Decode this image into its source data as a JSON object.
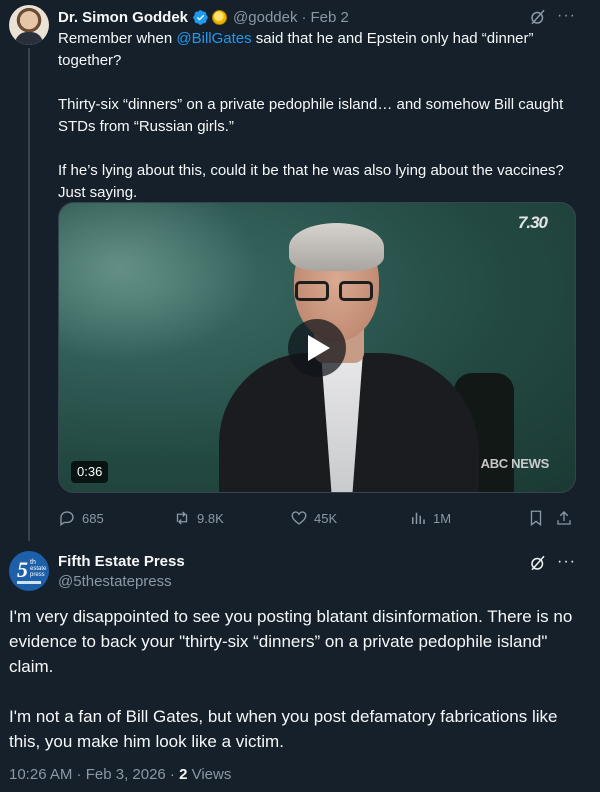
{
  "parent_tweet": {
    "author_name": "Dr. Simon Goddek",
    "handle": "@goddek",
    "separator": "·",
    "date": "Feb 2",
    "text_before_mention": "Remember when ",
    "mention": "@BillGates",
    "text_after_mention": " said that he and Epstein only had “dinner” together?",
    "paragraph_2": "Thirty-six “dinners” on a private pedophile island… and somehow Bill caught STDs from “Russian girls.”",
    "paragraph_3": "If he’s lying about this, could it be that he was also lying about the vaccines? Just saying.",
    "video": {
      "channel_logo": "7.30",
      "network_watermark": "ABC NEWS",
      "duration": "0:36"
    },
    "stats": {
      "replies": "685",
      "reposts": "9.8K",
      "likes": "45K",
      "views": "1M"
    }
  },
  "reply_tweet": {
    "author_name": "Fifth Estate Press",
    "handle": "@5thestatepress",
    "avatar_text": {
      "numeral": "5",
      "ordinal": "th",
      "line1": "estate",
      "line2": "press"
    },
    "paragraph_1": "I'm very disappointed to see you posting blatant disinformation. There is no evidence to back your \"thirty-six “dinners” on a private pedophile island\" claim.",
    "paragraph_2": "I'm not a fan of Bill Gates, but when you post defamatory fabrications like this, you make him look like a victim.",
    "timestamp": "10:26 AM · Feb 3, 2026 · ",
    "views_count": "2",
    "views_label": " Views"
  },
  "colors": {
    "background": "#15202b",
    "text_primary": "#f7f9f9",
    "text_secondary": "#8b98a5",
    "accent": "#1d9bf0",
    "divider": "#38444d"
  },
  "icons": [
    "verified-badge-icon",
    "gold-badge-icon",
    "grok-icon",
    "more-icon",
    "play-icon",
    "reply-icon",
    "repost-icon",
    "like-icon",
    "views-icon",
    "bookmark-icon",
    "share-icon"
  ]
}
